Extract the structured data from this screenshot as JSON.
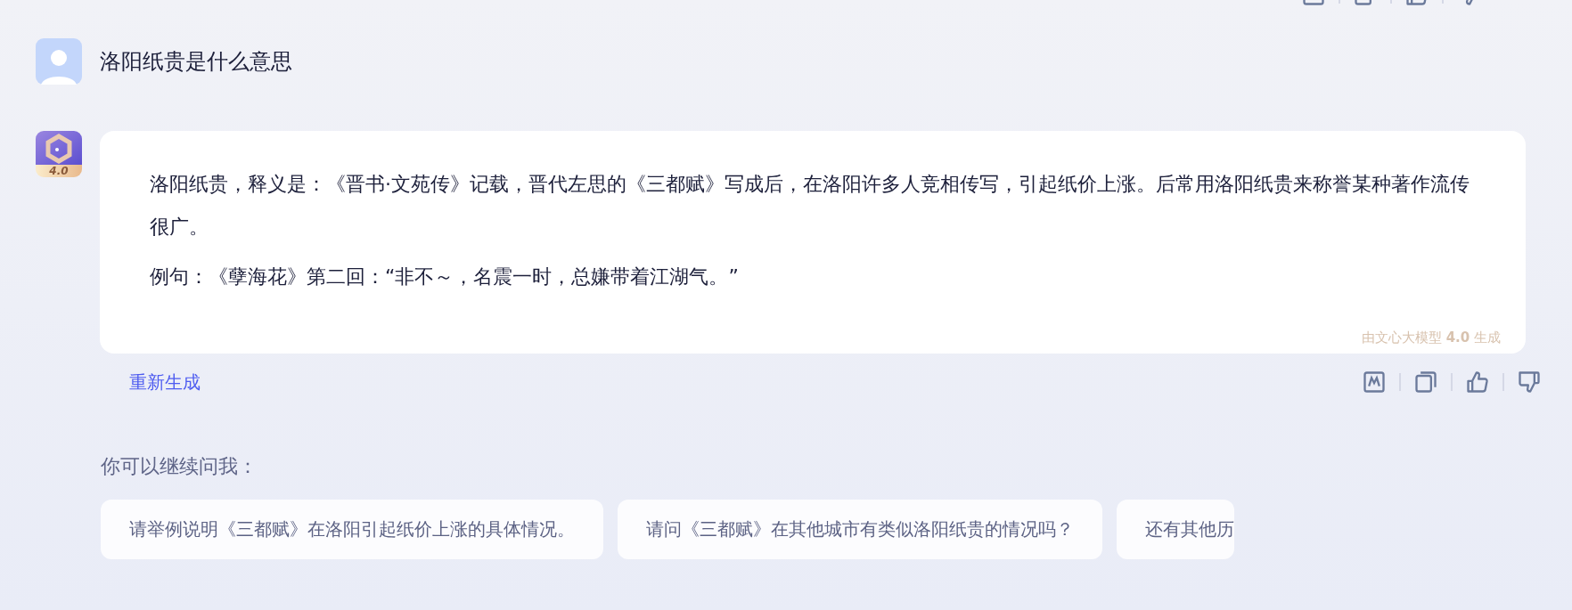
{
  "question": {
    "text": "洛阳纸贵是什么意思"
  },
  "answer": {
    "badge": "4.0",
    "paragraphs": [
      "洛阳纸贵，释义是：《晋书·文苑传》记载，晋代左思的《三都赋》写成后，在洛阳许多人竞相传写，引起纸价上涨。后常用洛阳纸贵来称誉某种著作流传很广。",
      "例句：《孽海花》第二回：“非不～，名震一时，总嫌带着江湖气。”"
    ],
    "watermark": "由文心大模型 **4.0** 生成"
  },
  "actions": {
    "regenerate": "重新生成"
  },
  "suggestions": {
    "title": "你可以继续问我：",
    "items": [
      "请举例说明《三都赋》在洛阳引起纸价上涨的具体情况。",
      "请问《三都赋》在其他城市有类似洛阳纸贵的情况吗？",
      "还有其他历"
    ]
  }
}
